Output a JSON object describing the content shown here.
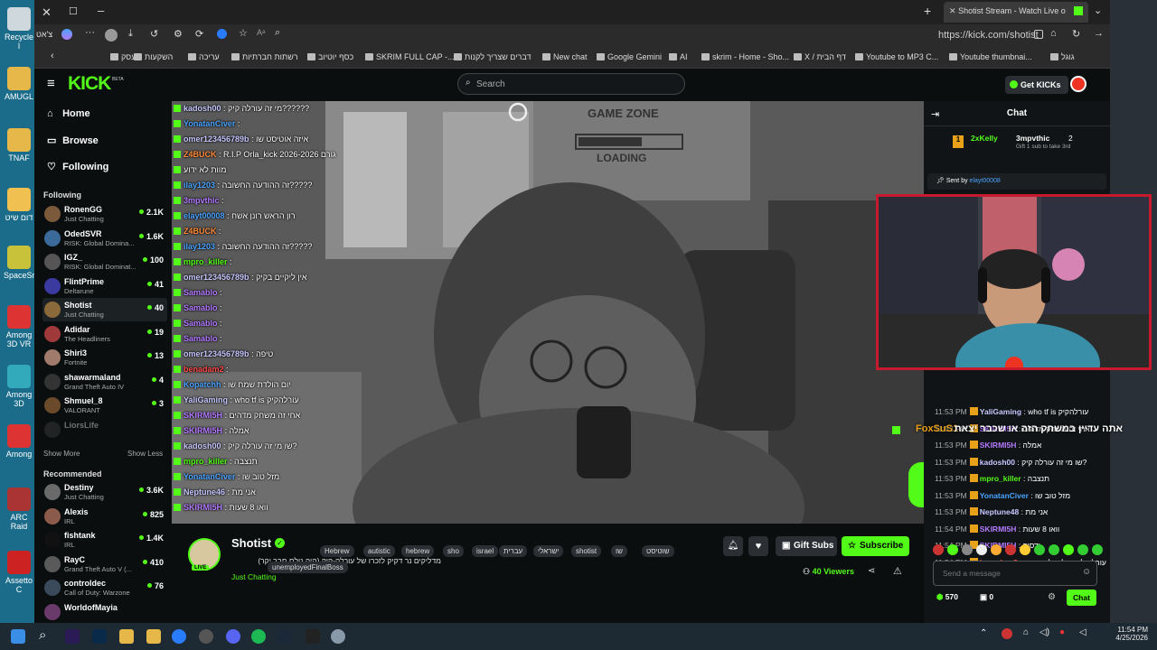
{
  "desktop": {
    "icons": [
      "Recycle I",
      "AMUGL",
      "TNAF",
      "דום שיט",
      "SpaceSni",
      "Among 3D VR",
      "Among 3D",
      "Among",
      "ARC Raid",
      "Assetto C"
    ]
  },
  "browser": {
    "tab_title": "Shotist Stream - Watch Live o",
    "profile_label": "צ'אט",
    "url": "https://kick.com/shotist",
    "favorites": [
      "עסק",
      "השקעות",
      "עריכה",
      "רשתות חברתיות",
      "כסף יוטיוב",
      "SKRIM FULL CAP -...",
      "New chat",
      "דברים שצריך לקנות",
      "Google Gemini",
      "AI",
      "skrim - Home - Sho...",
      "X / דף הבית",
      "Youtube to MP3 C...",
      "Youtube thumbnai...",
      "גוגל"
    ]
  },
  "kick": {
    "logo": "KICK",
    "beta": "BETA",
    "search_placeholder": "Search",
    "get_kicks": "Get KICKs",
    "nav": [
      {
        "icon": "home-icon",
        "label": "Home"
      },
      {
        "icon": "browse-icon",
        "label": "Browse"
      },
      {
        "icon": "heart-icon",
        "label": "Following"
      }
    ],
    "following_header": "Following",
    "following": [
      {
        "name": "RonenGG",
        "game": "Just Chatting",
        "viewers": "2.1K",
        "color": "#7a5a3a"
      },
      {
        "name": "OdedSVR",
        "game": "RISK: Global Domina...",
        "viewers": "1.6K",
        "color": "#3a6a9a"
      },
      {
        "name": "IGZ_",
        "game": "RISK: Global Dominat...",
        "viewers": "100",
        "color": "#555"
      },
      {
        "name": "FlintPrime",
        "game": "Deltarune",
        "viewers": "41",
        "color": "#3a3aa0"
      },
      {
        "name": "Shotist",
        "game": "Just Chatting",
        "viewers": "40",
        "color": "#8a6a3a"
      },
      {
        "name": "Adidar",
        "game": "The Headliners",
        "viewers": "19",
        "color": "#a03a3a"
      },
      {
        "name": "Shiri3",
        "game": "Fortnite",
        "viewers": "13",
        "color": "#a07a6a"
      },
      {
        "name": "shawarmaland",
        "game": "Grand Theft Auto IV",
        "viewers": "4",
        "color": "#333"
      },
      {
        "name": "Shmuel_8",
        "game": "VALORANT",
        "viewers": "3",
        "color": "#6a4a2a"
      },
      {
        "name": "LiorsLife",
        "game": "",
        "viewers": "",
        "color": "#444"
      }
    ],
    "show_more": "Show More",
    "show_less": "Show Less",
    "recommended_header": "Recommended",
    "recommended": [
      {
        "name": "Destiny",
        "game": "Just Chatting",
        "viewers": "3.6K",
        "color": "#6a6a6a"
      },
      {
        "name": "Alexis",
        "game": "IRL",
        "viewers": "825",
        "color": "#8a5a4a"
      },
      {
        "name": "fishtank",
        "game": "IRL",
        "viewers": "1.4K",
        "color": "#111"
      },
      {
        "name": "RayC",
        "game": "Grand Theft Auto V (...",
        "viewers": "410",
        "color": "#5a5a5a"
      },
      {
        "name": "controldec",
        "game": "Call of Duty: Warzone",
        "viewers": "76",
        "color": "#3a4a5a"
      },
      {
        "name": "WorldofMayia",
        "game": "",
        "viewers": "",
        "color": "#6a3a6a"
      }
    ],
    "video_overlay": {
      "sign_top": "GAME ZONE",
      "sign_bottom": "LOADING",
      "lines": [
        {
          "user": "kadosh00",
          "msg": "מי זה עורלה קיק??????",
          "color": "#c7c7ff"
        },
        {
          "user": "YonatanCiver",
          "msg": "",
          "color": "#4aa3ff"
        },
        {
          "user": "omer123456789b",
          "msg": "איזה אוטיסט שו",
          "color": "#c7c7ff"
        },
        {
          "user": "Z4BUCK",
          "msg": "R.I.P Orla_kick 2026-2026 גורם",
          "color": "#ff8a3a"
        },
        {
          "user": "",
          "msg": "מוות לא ידוע",
          "color": "#c7c7ff"
        },
        {
          "user": "ilay1203",
          "msg": "זה ההודעה החשובה?????",
          "color": "#4aa3ff"
        },
        {
          "user": "3mpvthic",
          "msg": "",
          "color": "#b37aff"
        },
        {
          "user": "elayt00008",
          "msg": "רון הראש רונן אשח",
          "color": "#4aa3ff"
        },
        {
          "user": "Z4BUCK",
          "msg": "",
          "color": "#ff8a3a"
        },
        {
          "user": "ilay1203",
          "msg": "זה ההודעה החשובה?????",
          "color": "#4aa3ff"
        },
        {
          "user": "mpro_killer",
          "msg": "",
          "color": "#53fc18"
        },
        {
          "user": "omer123456789b",
          "msg": "אין ליקיים בקיק",
          "color": "#c7c7ff"
        },
        {
          "user": "Samablo",
          "msg": "",
          "color": "#b37aff"
        },
        {
          "user": "Samablo",
          "msg": "",
          "color": "#b37aff"
        },
        {
          "user": "Samablo",
          "msg": "",
          "color": "#b37aff"
        },
        {
          "user": "Samablo",
          "msg": "",
          "color": "#b37aff"
        },
        {
          "user": "omer123456789b",
          "msg": "טיפה",
          "color": "#c7c7ff"
        },
        {
          "user": "benadam2",
          "msg": "",
          "color": "#ff4a4a"
        },
        {
          "user": "Kopatchh",
          "msg": "יום הולדת שמח שו",
          "color": "#4aa3ff"
        },
        {
          "user": "YaliGaming",
          "msg": "who tf is עורלהקיק",
          "color": "#c7c7ff"
        },
        {
          "user": "SKIRMI5H",
          "msg": "אחי זה משחק מדהים",
          "color": "#b37aff"
        },
        {
          "user": "SKIRMI5H",
          "msg": "אמלה",
          "color": "#b37aff"
        },
        {
          "user": "kadosh00",
          "msg": "שו מי זה עורלה קיק?",
          "color": "#c7c7ff"
        },
        {
          "user": "mpro_killer",
          "msg": "תנצבה",
          "color": "#53fc18"
        },
        {
          "user": "YonatanCiver",
          "msg": "מזל טוב שו",
          "color": "#4aa3ff"
        },
        {
          "user": "Neptune46",
          "msg": "אני מת",
          "color": "#c7c7ff"
        },
        {
          "user": "SKIRMI5H",
          "msg": "וואו 8 שעות",
          "color": "#b37aff"
        }
      ]
    },
    "stream": {
      "name": "Shotist",
      "title": "מדליקים נר דקיק לזכרו של עורלה-קיק (היה נולם חבר יקר)",
      "category": "Just Chatting",
      "live": "LIVE",
      "viewers": "40 Viewers",
      "gift_subs": "Gift Subs",
      "subscribe": "Subscribe",
      "tags": [
        "Hebrew",
        "autistic",
        "hebrew",
        "sho",
        "israel",
        "עברית",
        "ישראלי",
        "shotist",
        "שו",
        "שוטיסט",
        "unemployedFinalBoss"
      ]
    },
    "chat": {
      "title": "Chat",
      "leader1": {
        "name": "2xKelly",
        "rank": "1"
      },
      "leader2": {
        "name": "3mpvthic",
        "count": "2",
        "note": "Gift 1 sub to take 3rd"
      },
      "pinned_prefix": "Sent by",
      "pinned_user": "elayt00008",
      "messages": [
        {
          "time": "11:53 PM",
          "user": "YaliGaming",
          "msg": ": who tf is עורלהקיק",
          "color": "#c7c7ff"
        },
        {
          "time": "11:53 PM",
          "user": "SKIRMI5H",
          "msg": ": אחי זה משחק מדהים",
          "color": "#b37aff"
        },
        {
          "time": "11:53 PM",
          "user": "SKIRMI5H",
          "msg": ": אמלה",
          "color": "#b37aff"
        },
        {
          "time": "11:53 PM",
          "user": "kadosh00",
          "msg": ": שו מי זה עורלה קיק?",
          "color": "#c7c7ff"
        },
        {
          "time": "11:53 PM",
          "user": "mpro_killer",
          "msg": ": תנצבה",
          "color": "#53fc18"
        },
        {
          "time": "11:53 PM",
          "user": "YonatanCiver",
          "msg": ": מזל טוב שו",
          "color": "#4aa3ff"
        },
        {
          "time": "11:53 PM",
          "user": "Neptune48",
          "msg": ": אני מת",
          "color": "#c7c7ff"
        },
        {
          "time": "11:54 PM",
          "user": "SKIRMI5H",
          "msg": ": וואו 8 שעות",
          "color": "#b37aff"
        },
        {
          "time": "11:54 PM",
          "user": "SKIRMI5H",
          "msg": ": ידסוק",
          "color": "#b37aff"
        },
        {
          "time": "11:54 PM",
          "user": "benadam2",
          "msg": ": עורלה לא נסלח ולא נשכח",
          "color": "#ff4a4a"
        }
      ],
      "highlight_user": "FoxSuS1",
      "highlight_msg": "אתה עדיין במשחק הזה או שכבר יצאת",
      "input_placeholder": "Send a message",
      "points": "570",
      "count": "0",
      "send": "Chat"
    }
  },
  "taskbar": {
    "time": "11:54 PM",
    "date": "4/25/2026"
  }
}
